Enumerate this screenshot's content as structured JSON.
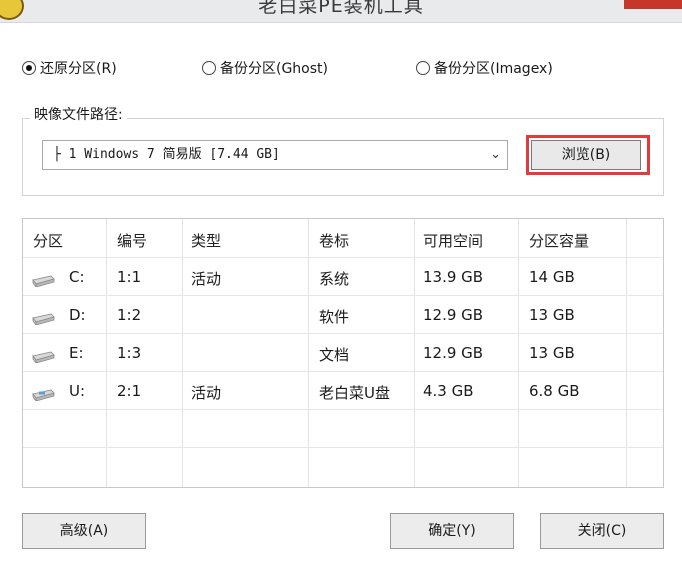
{
  "window": {
    "title": "老白菜PE装机工具"
  },
  "mode_options": [
    {
      "label": "还原分区(R)",
      "checked": true
    },
    {
      "label": "备份分区(Ghost)",
      "checked": false
    },
    {
      "label": "备份分区(Imagex)",
      "checked": false
    }
  ],
  "image_path": {
    "label": "映像文件路径:",
    "selected": "├ 1 Windows 7 简易版 [7.44 GB]",
    "browse_label": "浏览(B)"
  },
  "partitions": {
    "columns": [
      "分区",
      "编号",
      "类型",
      "卷标",
      "可用空间",
      "分区容量"
    ],
    "rows": [
      {
        "drive": "C:",
        "number": "1:1",
        "type": "活动",
        "label": "系统",
        "free": "13.9 GB",
        "capacity": "14 GB",
        "icon": "hard-drive-icon"
      },
      {
        "drive": "D:",
        "number": "1:2",
        "type": "",
        "label": "软件",
        "free": "12.9 GB",
        "capacity": "13 GB",
        "icon": "hard-drive-icon"
      },
      {
        "drive": "E:",
        "number": "1:3",
        "type": "",
        "label": "文档",
        "free": "12.9 GB",
        "capacity": "13 GB",
        "icon": "hard-drive-icon"
      },
      {
        "drive": "U:",
        "number": "2:1",
        "type": "活动",
        "label": "老白菜U盘",
        "free": "4.3 GB",
        "capacity": "6.8 GB",
        "icon": "usb-drive-icon"
      }
    ]
  },
  "buttons": {
    "advanced": "高级(A)",
    "ok": "确定(Y)",
    "close": "关闭(C)"
  },
  "colors": {
    "highlight": "#e23b3b",
    "title_close": "#c7362b"
  }
}
